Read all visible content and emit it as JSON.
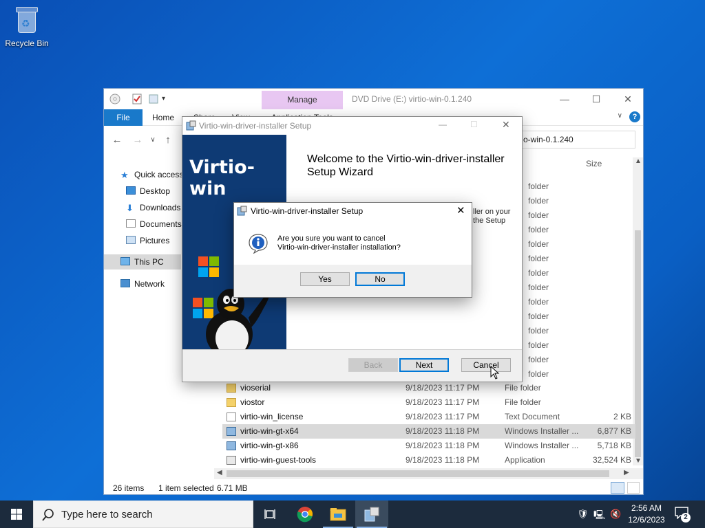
{
  "desktop": {
    "recycle_bin_label": "Recycle Bin"
  },
  "explorer": {
    "manage_tab": "Manage",
    "title": "DVD Drive (E:) virtio-win-0.1.240",
    "ribbon_tabs": [
      "File",
      "Home",
      "Share",
      "View",
      "Application Tools"
    ],
    "address": "o-win-0.1.240",
    "sidebar": {
      "quick_access": "Quick access",
      "desktop": "Desktop",
      "downloads": "Downloads",
      "documents": "Documents",
      "pictures": "Pictures",
      "this_pc": "This PC",
      "network": "Network"
    },
    "col_size": "Size",
    "bg_folder_label": "folder",
    "rows": [
      {
        "name": "vioserial",
        "date": "9/18/2023 11:17 PM",
        "type": "File folder",
        "size": "",
        "icon": "folder-icon"
      },
      {
        "name": "viostor",
        "date": "9/18/2023 11:17 PM",
        "type": "File folder",
        "size": "",
        "icon": "folder-icon"
      },
      {
        "name": "virtio-win_license",
        "date": "9/18/2023 11:17 PM",
        "type": "Text Document",
        "size": "2 KB",
        "icon": "text-file-icon"
      },
      {
        "name": "virtio-win-gt-x64",
        "date": "9/18/2023 11:18 PM",
        "type": "Windows Installer ...",
        "size": "6,877 KB",
        "icon": "installer-icon"
      },
      {
        "name": "virtio-win-gt-x86",
        "date": "9/18/2023 11:18 PM",
        "type": "Windows Installer ...",
        "size": "5,718 KB",
        "icon": "installer-icon"
      },
      {
        "name": "virtio-win-guest-tools",
        "date": "9/18/2023 11:18 PM",
        "type": "Application",
        "size": "32,524 KB",
        "icon": "application-icon"
      }
    ],
    "status": {
      "items": "26 items",
      "selected": "1 item selected",
      "selected_size": "6.71 MB"
    }
  },
  "installer": {
    "title": "Virtio-win-driver-installer Setup",
    "brand": "Virtio-win",
    "welcome_title": "Welcome to the Virtio-win-driver-installer Setup Wizard",
    "body_line1": "ller on your",
    "body_line2": "the Setup",
    "back": "Back",
    "next": "Next",
    "cancel": "Cancel"
  },
  "dialog": {
    "title": "Virtio-win-driver-installer Setup",
    "message_line1": "Are you sure you want to cancel",
    "message_line2": "Virtio-win-driver-installer installation?",
    "yes": "Yes",
    "no": "No"
  },
  "taskbar": {
    "search_placeholder": "Type here to search",
    "time": "2:56 AM",
    "date": "12/6/2023",
    "notification_count": "2"
  },
  "colors": {
    "accent": "#0078d7",
    "manage_tab": "#e8c7f2",
    "banner": "#0e3a74",
    "taskbar": "#1c2b3d"
  }
}
